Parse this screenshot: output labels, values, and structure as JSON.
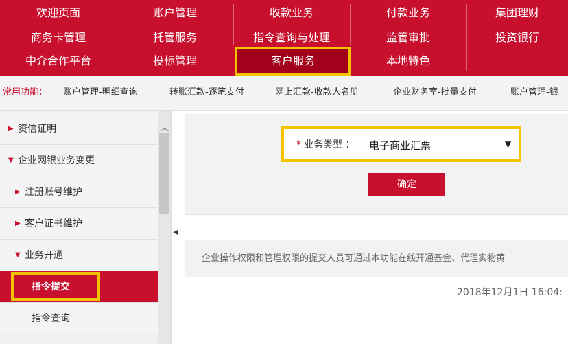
{
  "top_nav": {
    "items": [
      [
        "欢迎页面",
        "账户管理",
        "收款业务",
        "付款业务",
        "集团理财"
      ],
      [
        "商务卡管理",
        "托管服务",
        "指令查询与处理",
        "监管审批",
        "投资银行"
      ],
      [
        "中介合作平台",
        "投标管理",
        "客户服务",
        "本地特色",
        ""
      ]
    ],
    "active": "客户服务"
  },
  "quick_bar": {
    "label": "常用功能：",
    "links": [
      "账户管理-明细查询",
      "转账汇款-逐笔支付",
      "网上汇款-收款人名册",
      "企业财务室-批量支付",
      "账户管理-银"
    ]
  },
  "sidebar": {
    "items": [
      {
        "label": "资信证明",
        "level": 1,
        "expanded": false
      },
      {
        "label": "企业网银业务变更",
        "level": 1,
        "expanded": true
      },
      {
        "label": "注册账号维护",
        "level": 2,
        "expanded": false
      },
      {
        "label": "客户证书维护",
        "level": 2,
        "expanded": false
      },
      {
        "label": "业务开通",
        "level": 2,
        "expanded": true
      },
      {
        "label": "指令提交",
        "level": 3,
        "active": true
      },
      {
        "label": "指令查询",
        "level": 3,
        "active": false
      }
    ]
  },
  "form": {
    "business_type_label": "业务类型 ：",
    "required_mark": "*",
    "business_type_value": "电子商业汇票",
    "confirm_label": "确定"
  },
  "notice": "企业操作权限和管理权限的提交人员可通过本功能在线开通基金、代理实物黄",
  "timestamp": "2018年12月1日 16:04:",
  "colors": {
    "brand_red": "#c8102e",
    "highlight_yellow": "#f5c400"
  },
  "icons": {
    "collapsed_triangle": "triangle-right-icon",
    "expanded_triangle": "triangle-down-icon",
    "scroll_up": "chevron-up-icon",
    "collapse_handle": "triangle-left-icon",
    "dropdown": "caret-down-icon"
  }
}
